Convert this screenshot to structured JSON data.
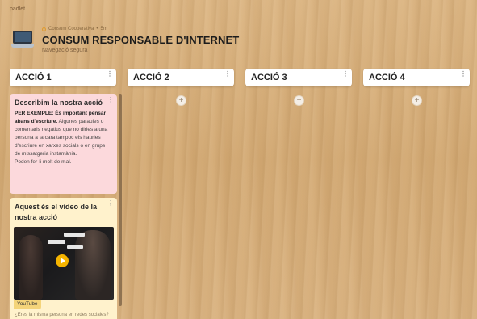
{
  "brand": "padlet",
  "board": {
    "author": "Consum Cooperativa",
    "time": "5m",
    "title": "CONSUM RESPONSABLE D'INTERNET",
    "subtitle": "Navegació segura"
  },
  "columns": [
    {
      "title": "ACCIÓ 1"
    },
    {
      "title": "ACCIÓ 2"
    },
    {
      "title": "ACCIÓ 3"
    },
    {
      "title": "ACCIÓ 4"
    }
  ],
  "ui": {
    "menu_glyph": "⋮",
    "add_glyph": "+",
    "meta_sep": "•"
  },
  "posts": [
    {
      "title": "Describim la nostra acció",
      "lead": "PER EXEMPLE: És important pensar abans d'escriure.",
      "body": "Algunes paraules o comentaris negatius que no diries a una persona a la cara tampoc els hauries d'escriure en xarxes socials o en grups de missatgeria instantània.",
      "tail": "Poden fer-li molt de mal.",
      "color": "#fcd9dc"
    },
    {
      "title": "Aquest és el vídeo de la nostra acció",
      "video_source": "YouTube",
      "video_caption": "¿Eres la misma persona en redes sociales?",
      "color": "#fff2cc"
    }
  ],
  "icons": [
    "laptop-icon",
    "more-icon",
    "add-icon",
    "play-icon"
  ]
}
